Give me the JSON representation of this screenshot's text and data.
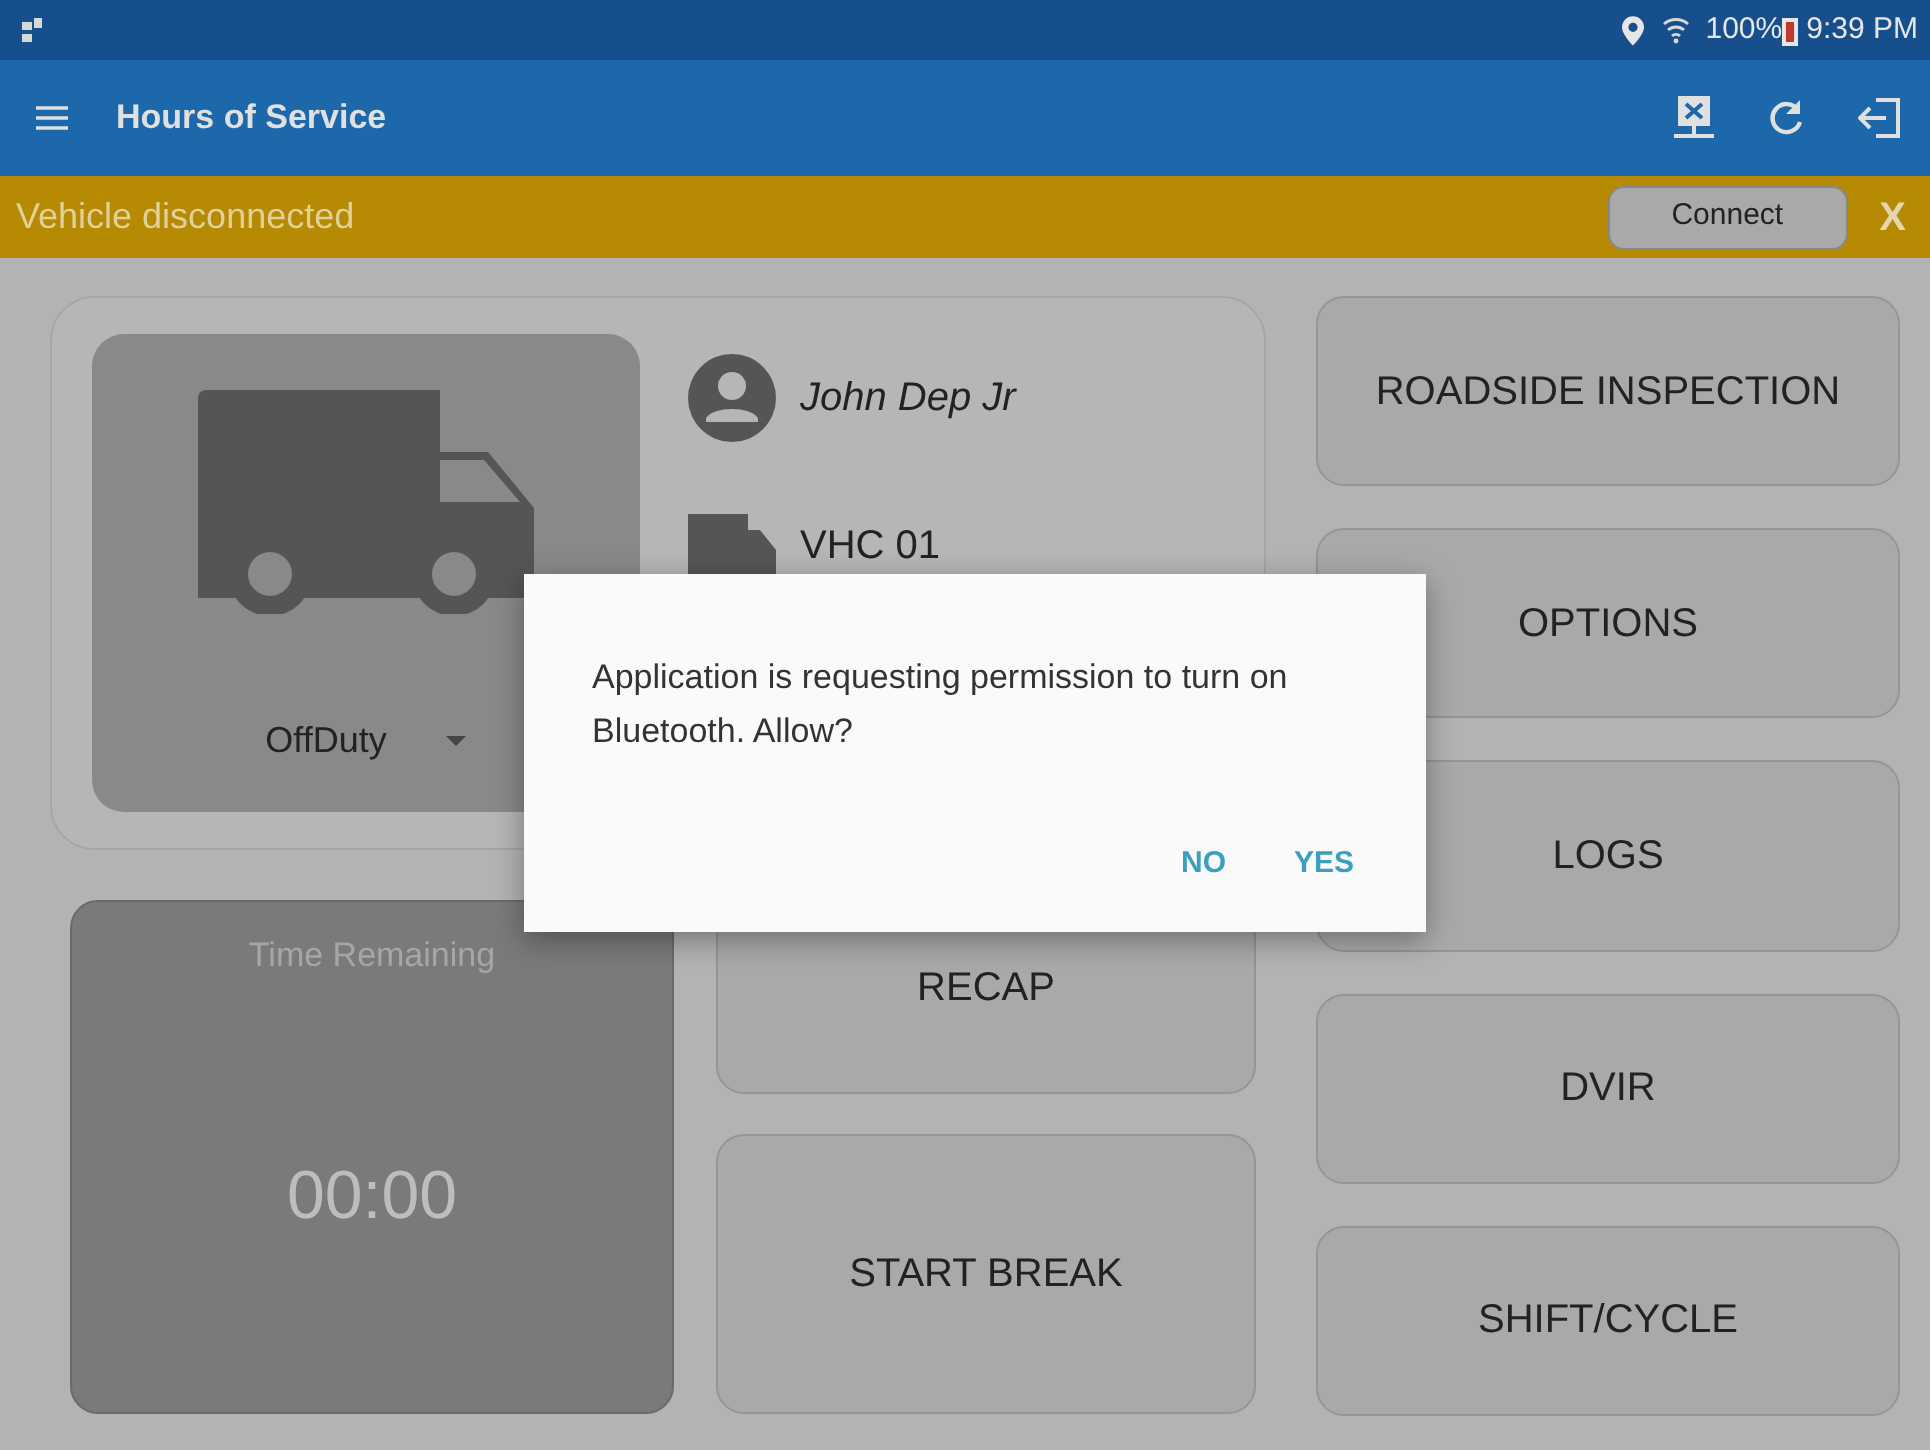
{
  "status_bar": {
    "battery": "100%",
    "time": "9:39 PM"
  },
  "toolbar": {
    "title": "Hours of Service"
  },
  "banner": {
    "message": "Vehicle disconnected",
    "button": "Connect",
    "close": "X"
  },
  "driver_card": {
    "status": "OffDuty",
    "driver": "John Dep Jr",
    "vehicle": "VHC 01"
  },
  "time_remaining": {
    "label": "Time Remaining",
    "value": "00:00"
  },
  "center_buttons": [
    "RECAP",
    "START BREAK"
  ],
  "menu_buttons": [
    "ROADSIDE INSPECTION",
    "OPTIONS",
    "LOGS",
    "DVIR",
    "SHIFT/CYCLE"
  ],
  "dialog": {
    "message": "Application is requesting permission to turn on Bluetooth. Allow?",
    "buttons": [
      "NO",
      "YES"
    ]
  }
}
